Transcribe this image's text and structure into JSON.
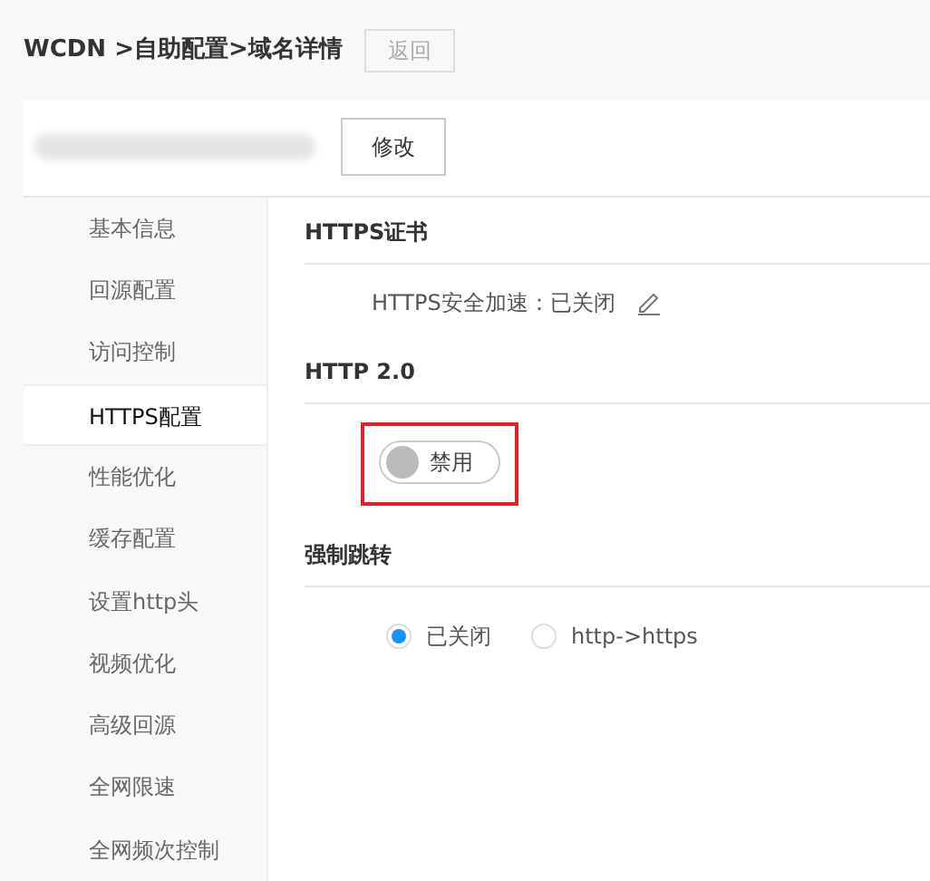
{
  "breadcrumb": "WCDN >自助配置>域名详情",
  "back_button": "返回",
  "domain": {
    "redacted": true,
    "edit_button": "修改"
  },
  "sidebar": {
    "items": [
      {
        "label": "基本信息",
        "selected": false
      },
      {
        "label": "回源配置",
        "selected": false
      },
      {
        "label": "访问控制",
        "selected": false
      },
      {
        "label": "HTTPS配置",
        "selected": true
      },
      {
        "label": "性能优化",
        "selected": false
      },
      {
        "label": "缓存配置",
        "selected": false
      },
      {
        "label": "设置http头",
        "selected": false
      },
      {
        "label": "视频优化",
        "selected": false
      },
      {
        "label": "高级回源",
        "selected": false
      },
      {
        "label": "全网限速",
        "selected": false
      },
      {
        "label": "全网频次控制",
        "selected": false
      }
    ]
  },
  "sections": [
    {
      "title": "HTTPS证书",
      "kind": "status",
      "text": "HTTPS安全加速：已关闭"
    },
    {
      "title": "HTTP 2.0",
      "kind": "switch",
      "switch": {
        "label": "禁用",
        "on": false,
        "highlighted": true
      }
    },
    {
      "title": "强制跳转",
      "kind": "radios",
      "options": [
        {
          "label": "已关闭",
          "selected": true
        },
        {
          "label": "http->https",
          "selected": false
        }
      ]
    }
  ]
}
